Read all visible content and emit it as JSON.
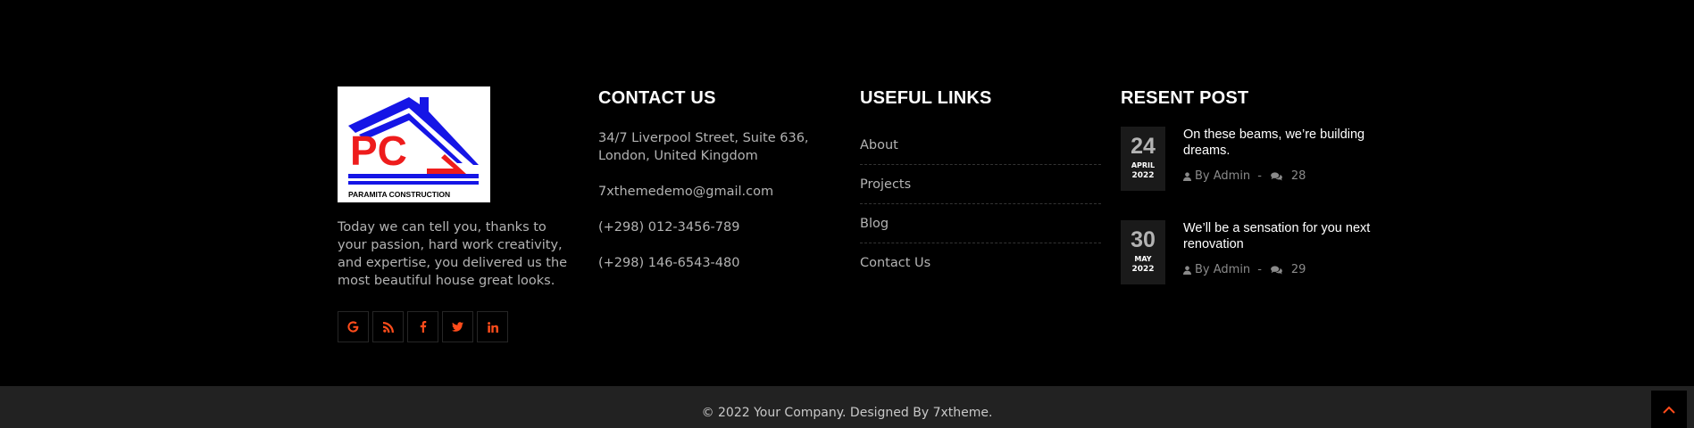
{
  "brand": {
    "logo_initials": "PC",
    "logo_text": "PARAMITA CONSTRUCTION",
    "about_text": "Today we can tell you, thanks to your passion, hard work creativity, and expertise, you delivered us the most beautiful house great looks."
  },
  "social": [
    {
      "icon": "google-icon"
    },
    {
      "icon": "rss-icon"
    },
    {
      "icon": "facebook-icon"
    },
    {
      "icon": "twitter-icon"
    },
    {
      "icon": "linkedin-icon"
    }
  ],
  "contact": {
    "heading": "CONTACT US",
    "address": "34/7 Liverpool Street, Suite 636, London, United Kingdom",
    "email": "7xthemedemo@gmail.com",
    "phone1": "(+298) 012-3456-789",
    "phone2": "(+298) 146-6543-480"
  },
  "useful_links": {
    "heading": "USEFUL LINKS",
    "items": [
      "About",
      "Projects",
      "Blog",
      "Contact Us"
    ]
  },
  "recent_posts": {
    "heading": "RESENT POST",
    "posts": [
      {
        "day": "24",
        "month": "APRIL",
        "year": "2022",
        "title": "On these beams, we’re building dreams.",
        "author": "By Admin",
        "separator": "-",
        "comments": "28"
      },
      {
        "day": "30",
        "month": "MAY",
        "year": "2022",
        "title": "We’ll be a sensation for you next renovation",
        "author": "By Admin",
        "separator": "-",
        "comments": "29"
      }
    ]
  },
  "footer_bottom": {
    "copyright": "© 2022 Your Company. Designed By 7xtheme."
  },
  "colors": {
    "accent": "#ff4c1b",
    "background": "#000000",
    "bottom_bar": "#222222",
    "logo_blue": "#1515e6",
    "logo_red": "#ee1c1c"
  }
}
